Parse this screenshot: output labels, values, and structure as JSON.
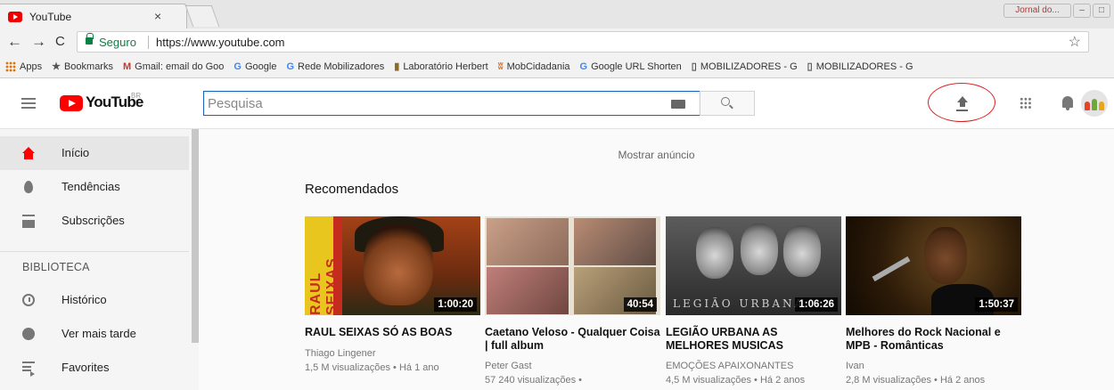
{
  "browser": {
    "tab_title": "YouTube",
    "tab_close": "×",
    "window_user": "Jornal do...",
    "back": "←",
    "forward": "→",
    "reload": "C",
    "secure_label": "Seguro",
    "url": "https://www.youtube.com",
    "star": "☆",
    "bookmarks": [
      {
        "icon": "",
        "label": "Apps",
        "icon_color": "#e37400"
      },
      {
        "icon": "★",
        "label": "Bookmarks",
        "icon_color": "#555"
      },
      {
        "icon": "M",
        "label": "Gmail: email do Goo",
        "icon_color": "#d93025"
      },
      {
        "icon": "G",
        "label": "Google",
        "icon_color": "#4285f4"
      },
      {
        "icon": "G",
        "label": "Rede Mobilizadores",
        "icon_color": "#4285f4"
      },
      {
        "icon": "▮",
        "label": "Laboratório Herbert",
        "icon_color": "#8a6b2a"
      },
      {
        "icon": "ʬ",
        "label": "MobCidadania",
        "icon_color": "#e06b20"
      },
      {
        "icon": "G",
        "label": "Google URL Shorten",
        "icon_color": "#4285f4"
      },
      {
        "icon": "▯",
        "label": "MOBILIZADORES - G",
        "icon_color": "#555"
      },
      {
        "icon": "▯",
        "label": "MOBILIZADORES - G",
        "icon_color": "#555"
      }
    ]
  },
  "masthead": {
    "logo_text": "YouTube",
    "country": "BR",
    "search_placeholder": "Pesquisa",
    "accent_color": "#ff0000"
  },
  "sidebar": {
    "items": [
      {
        "label": "Início",
        "icon": "home-icon",
        "active": true
      },
      {
        "label": "Tendências",
        "icon": "trending-icon"
      },
      {
        "label": "Subscrições",
        "icon": "subscriptions-icon"
      }
    ],
    "library_header": "BIBLIOTECA",
    "library_items": [
      {
        "label": "Histórico",
        "icon": "history-icon"
      },
      {
        "label": "Ver mais tarde",
        "icon": "watch-later-icon"
      },
      {
        "label": "Favorites",
        "icon": "playlist-icon"
      }
    ]
  },
  "main": {
    "ad_text": "Mostrar anúncio",
    "section_title": "Recomendados",
    "videos": [
      {
        "title": "RAUL SEIXAS SÓ AS BOAS",
        "channel": "Thiago Lingener",
        "meta": "1,5 M visualizações • Há 1 ano",
        "duration": "1:00:20",
        "thumb_text": "RAUL SEIXAS"
      },
      {
        "title": "Caetano Veloso - Qualquer Coisa | full album",
        "channel": "Peter Gast",
        "meta": "57 240 visualizações •",
        "duration": "40:54"
      },
      {
        "title": "LEGIÃO URBANA AS MELHORES MUSICAS",
        "channel": "EMOÇÕES APAIXONANTES",
        "meta": "4,5 M visualizações • Há 2 anos",
        "duration": "1:06:26",
        "thumb_text": "LEGIÃO URBANA"
      },
      {
        "title": "Melhores do Rock Nacional e MPB - Românticas",
        "channel": "Ivan",
        "meta": "2,8 M visualizações • Há 2 anos",
        "duration": "1:50:37"
      }
    ]
  }
}
